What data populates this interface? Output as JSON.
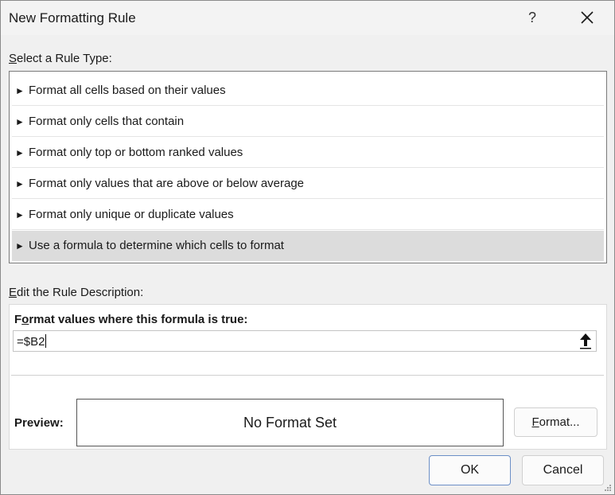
{
  "window": {
    "title": "New Formatting Rule",
    "help_label": "?",
    "close_icon": "close-icon"
  },
  "rule_type": {
    "label_mnemonic": "S",
    "label_rest": "elect a Rule Type:",
    "marker": "►",
    "items": [
      {
        "label": "Format all cells based on their values",
        "selected": false
      },
      {
        "label": "Format only cells that contain",
        "selected": false
      },
      {
        "label": "Format only top or bottom ranked values",
        "selected": false
      },
      {
        "label": "Format only values that are above or below average",
        "selected": false
      },
      {
        "label": "Format only unique or duplicate values",
        "selected": false
      },
      {
        "label": "Use a formula to determine which cells to format",
        "selected": true
      }
    ]
  },
  "description": {
    "label_mnemonic": "E",
    "label_rest": "dit the Rule Description:",
    "heading_start": "F",
    "heading_mnemonic": "o",
    "heading_rest": "rmat values where this formula is true:",
    "formula_value": "=$B2",
    "collapse_icon": "arrow-up-collapse-icon",
    "preview_label": "Preview:",
    "preview_text": "No Format Set",
    "format_button_mnemonic": "F",
    "format_button_rest": "ormat..."
  },
  "buttons": {
    "ok": "OK",
    "cancel": "Cancel"
  },
  "colors": {
    "selected_row": "#dcdcdc",
    "ok_border": "#6c8fc7"
  }
}
